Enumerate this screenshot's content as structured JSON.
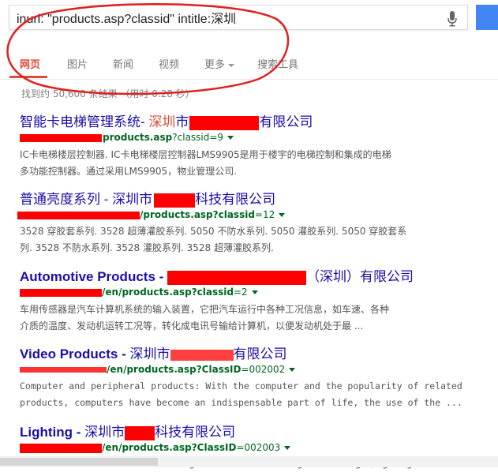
{
  "search": {
    "query": "inurl: \"products.asp?classid\" intitle:深圳"
  },
  "tabs": [
    {
      "label": "网页",
      "active": true
    },
    {
      "label": "图片"
    },
    {
      "label": "新闻"
    },
    {
      "label": "视频"
    },
    {
      "label": "更多"
    },
    {
      "label": "搜索工具"
    }
  ],
  "stats": "找到约 50,600 条结果 （用时 0.28 秒）",
  "results": [
    {
      "title_a": "智能卡电梯管理系统- ",
      "title_hl": "深圳",
      "title_b": "市",
      "title_c": "有限公司",
      "url": "products.asp",
      "url_param": "?classid=9",
      "snippet_1": "IC卡电梯楼层控制器. IC卡电梯楼层控制器LMS9905是用于楼宇的电梯控制和集成的电梯",
      "snippet_2": "多功能控制器。通过采用LMS9905，物业管理公司."
    },
    {
      "title_a": "普通亮度系列 - 深圳市",
      "title_b": "科技有限公司",
      "url": "/products.asp?classid",
      "url_param": "=12",
      "snippet_1": "3528 穿胶套系列. 3528 超薄灌胶系列. 5050 不防水系列. 5050 灌胶系列. 5050 穿胶套系",
      "snippet_2": "列. 3528 不防水系列. 3528 灌胶系列. 3528 超薄灌胶系列."
    },
    {
      "title_a": "Automotive Products - ",
      "title_b": "（深圳）有限公司",
      "url": "/en/products.asp?classid",
      "url_param": "=2",
      "snippet_1": "车用传感器是汽车计算机系统的输入装置，它把汽车运行中各种工况信息，如车速、各种",
      "snippet_2": "介质的温度、发动机运转工况等，转化成电讯号输给计算机，以便发动机处于最 ..."
    },
    {
      "title_a": "Video Products - ",
      "title_b": "深圳市",
      "title_c": "有限公司",
      "url": "/en/products.asp?ClassID",
      "url_param": "=002002",
      "snippet_1": "Computer and peripheral products: With the computer and the popularity of related",
      "snippet_2": "products, computers have become an indispensable part of life, the use of the ..."
    },
    {
      "title_a": "Lighting - ",
      "title_b": "深圳市",
      "title_c": "科技有限公司",
      "url": "/en/products.asp?ClassID",
      "url_param": "=002003",
      "snippet_1": "t lights at the same time give us a bright, lighting the"
    }
  ],
  "colors": {
    "accent": "#dd4b39",
    "link": "#1a0dab",
    "url": "#006621",
    "redaction": "#ff0000",
    "blue_button": "#4285f4"
  }
}
